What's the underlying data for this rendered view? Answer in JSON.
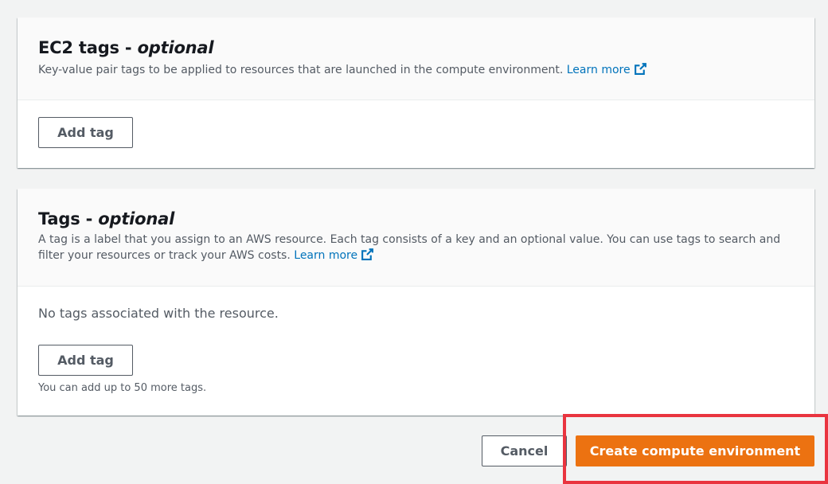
{
  "ec2_tags": {
    "title": "EC2 tags - ",
    "title_optional": "optional",
    "description": "Key-value pair tags to be applied to resources that are launched in the compute environment.",
    "learn_more": "Learn more",
    "add_tag_label": "Add tag"
  },
  "tags": {
    "title": "Tags - ",
    "title_optional": "optional",
    "description": "A tag is a label that you assign to an AWS resource. Each tag consists of a key and an optional value. You can use tags to search and filter your resources or track your AWS costs.",
    "learn_more": "Learn more",
    "empty_text": "No tags associated with the resource.",
    "add_tag_label": "Add tag",
    "limit_hint": "You can add up to 50 more tags."
  },
  "actions": {
    "cancel_label": "Cancel",
    "create_label": "Create compute environment"
  },
  "colors": {
    "primary": "#ec7211",
    "link": "#0073bb",
    "highlight": "#e9343f"
  },
  "icons": {
    "external_link": "external-link-icon"
  }
}
